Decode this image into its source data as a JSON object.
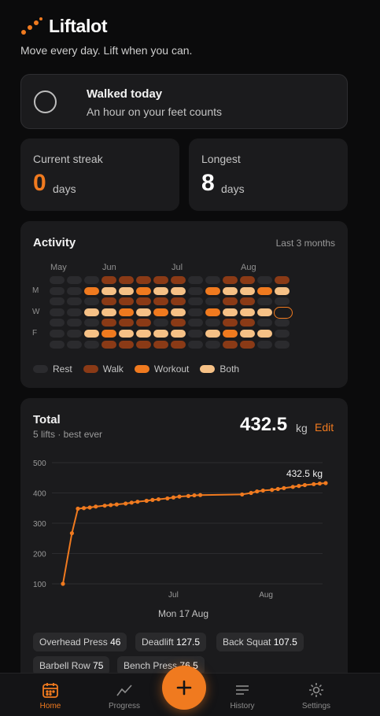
{
  "app": {
    "name": "Liftalot",
    "tagline": "Move every day. Lift when you can.",
    "accent": "#f07a1f"
  },
  "walk_card": {
    "title": "Walked today",
    "subtitle": "An hour on your feet counts",
    "checked": false
  },
  "stats": {
    "current_streak": {
      "label": "Current streak",
      "value": "0",
      "unit": "days"
    },
    "longest": {
      "label": "Longest",
      "value": "8",
      "unit": "days"
    }
  },
  "activity": {
    "title": "Activity",
    "range": "Last 3 months",
    "months": [
      {
        "label": "May",
        "week": 0
      },
      {
        "label": "Jun",
        "week": 3
      },
      {
        "label": "Jul",
        "week": 7
      },
      {
        "label": "Aug",
        "week": 11
      }
    ],
    "day_labels": [
      {
        "label": "M",
        "row": 1
      },
      {
        "label": "W",
        "row": 3
      },
      {
        "label": "F",
        "row": 5
      }
    ],
    "colors": {
      "rest": "#2b2b2e",
      "walk": "#8a3a16",
      "workout": "#f07a1f",
      "both": "#f6c186"
    },
    "legend": [
      {
        "key": "rest",
        "label": "Rest"
      },
      {
        "key": "walk",
        "label": "Walk"
      },
      {
        "key": "workout",
        "label": "Workout"
      },
      {
        "key": "both",
        "label": "Both"
      }
    ],
    "weeks": [
      [
        "r",
        "r",
        "r",
        "r",
        "r",
        "r",
        "r"
      ],
      [
        "r",
        "r",
        "r",
        "r",
        "r",
        "r",
        "r"
      ],
      [
        "r",
        "o",
        "r",
        "b",
        "r",
        "b",
        "r"
      ],
      [
        "w",
        "b",
        "w",
        "b",
        "w",
        "o",
        "w"
      ],
      [
        "w",
        "b",
        "w",
        "o",
        "w",
        "b",
        "w"
      ],
      [
        "w",
        "o",
        "w",
        "b",
        "w",
        "b",
        "w"
      ],
      [
        "w",
        "b",
        "w",
        "o",
        "r",
        "b",
        "w"
      ],
      [
        "w",
        "b",
        "w",
        "b",
        "w",
        "b",
        "w"
      ],
      [
        "r",
        "r",
        "r",
        "r",
        "r",
        "r",
        "r"
      ],
      [
        "r",
        "o",
        "r",
        "o",
        "r",
        "b",
        "r"
      ],
      [
        "w",
        "b",
        "w",
        "b",
        "w",
        "o",
        "w"
      ],
      [
        "w",
        "b",
        "w",
        "b",
        "w",
        "b",
        "w"
      ],
      [
        "r",
        "o",
        "r",
        "b",
        "r",
        "b",
        "r"
      ],
      [
        "w",
        "b",
        "r",
        "today",
        "r",
        "r",
        "r"
      ]
    ]
  },
  "total": {
    "title": "Total",
    "subtitle": "5 lifts · best ever",
    "value": "432.5",
    "unit": "kg",
    "edit_label": "Edit",
    "hover_date": "Mon 17 Aug",
    "peak_label": "432.5 kg",
    "lifts": [
      {
        "name": "Overhead Press",
        "value": "46"
      },
      {
        "name": "Deadlift",
        "value": "127.5"
      },
      {
        "name": "Back Squat",
        "value": "107.5"
      },
      {
        "name": "Barbell Row",
        "value": "75"
      },
      {
        "name": "Bench Press",
        "value": "76.5"
      }
    ]
  },
  "chart_data": {
    "type": "line",
    "ylim": [
      100,
      500
    ],
    "yticks": [
      "500",
      "400",
      "300",
      "200",
      "100"
    ],
    "xticks": [
      {
        "label": "Jul",
        "date": "2026-07-01"
      },
      {
        "label": "Aug",
        "date": "2026-08-01"
      }
    ],
    "series": [
      {
        "points": [
          {
            "date": "2026-05-25",
            "value": 100
          },
          {
            "date": "2026-05-28",
            "value": 267
          },
          {
            "date": "2026-05-30",
            "value": 348
          },
          {
            "date": "2026-06-01",
            "value": 350
          },
          {
            "date": "2026-06-03",
            "value": 352
          },
          {
            "date": "2026-06-05",
            "value": 355
          },
          {
            "date": "2026-06-08",
            "value": 358
          },
          {
            "date": "2026-06-10",
            "value": 360
          },
          {
            "date": "2026-06-12",
            "value": 362
          },
          {
            "date": "2026-06-15",
            "value": 365
          },
          {
            "date": "2026-06-17",
            "value": 368
          },
          {
            "date": "2026-06-19",
            "value": 371
          },
          {
            "date": "2026-06-22",
            "value": 374
          },
          {
            "date": "2026-06-24",
            "value": 377
          },
          {
            "date": "2026-06-26",
            "value": 379
          },
          {
            "date": "2026-06-29",
            "value": 382
          },
          {
            "date": "2026-07-01",
            "value": 385
          },
          {
            "date": "2026-07-03",
            "value": 388
          },
          {
            "date": "2026-07-06",
            "value": 390
          },
          {
            "date": "2026-07-08",
            "value": 392
          },
          {
            "date": "2026-07-10",
            "value": 393
          },
          {
            "date": "2026-07-24",
            "value": 395
          },
          {
            "date": "2026-07-27",
            "value": 400
          },
          {
            "date": "2026-07-29",
            "value": 405
          },
          {
            "date": "2026-07-31",
            "value": 408
          },
          {
            "date": "2026-08-03",
            "value": 410
          },
          {
            "date": "2026-08-05",
            "value": 413
          },
          {
            "date": "2026-08-07",
            "value": 416
          },
          {
            "date": "2026-08-10",
            "value": 420
          },
          {
            "date": "2026-08-12",
            "value": 423
          },
          {
            "date": "2026-08-14",
            "value": 426
          },
          {
            "date": "2026-08-17",
            "value": 429
          },
          {
            "date": "2026-08-19",
            "value": 431
          },
          {
            "date": "2026-08-21",
            "value": 432.5
          }
        ]
      }
    ],
    "grid": true,
    "line_color": "#f07a1f"
  },
  "nav": {
    "items": [
      {
        "label": "Home",
        "icon": "calendar-icon",
        "active": true
      },
      {
        "label": "Progress",
        "icon": "trend-icon",
        "active": false
      },
      {
        "label": "History",
        "icon": "list-icon",
        "active": false
      },
      {
        "label": "Settings",
        "icon": "gear-icon",
        "active": false
      }
    ],
    "fab_icon": "plus-icon"
  }
}
